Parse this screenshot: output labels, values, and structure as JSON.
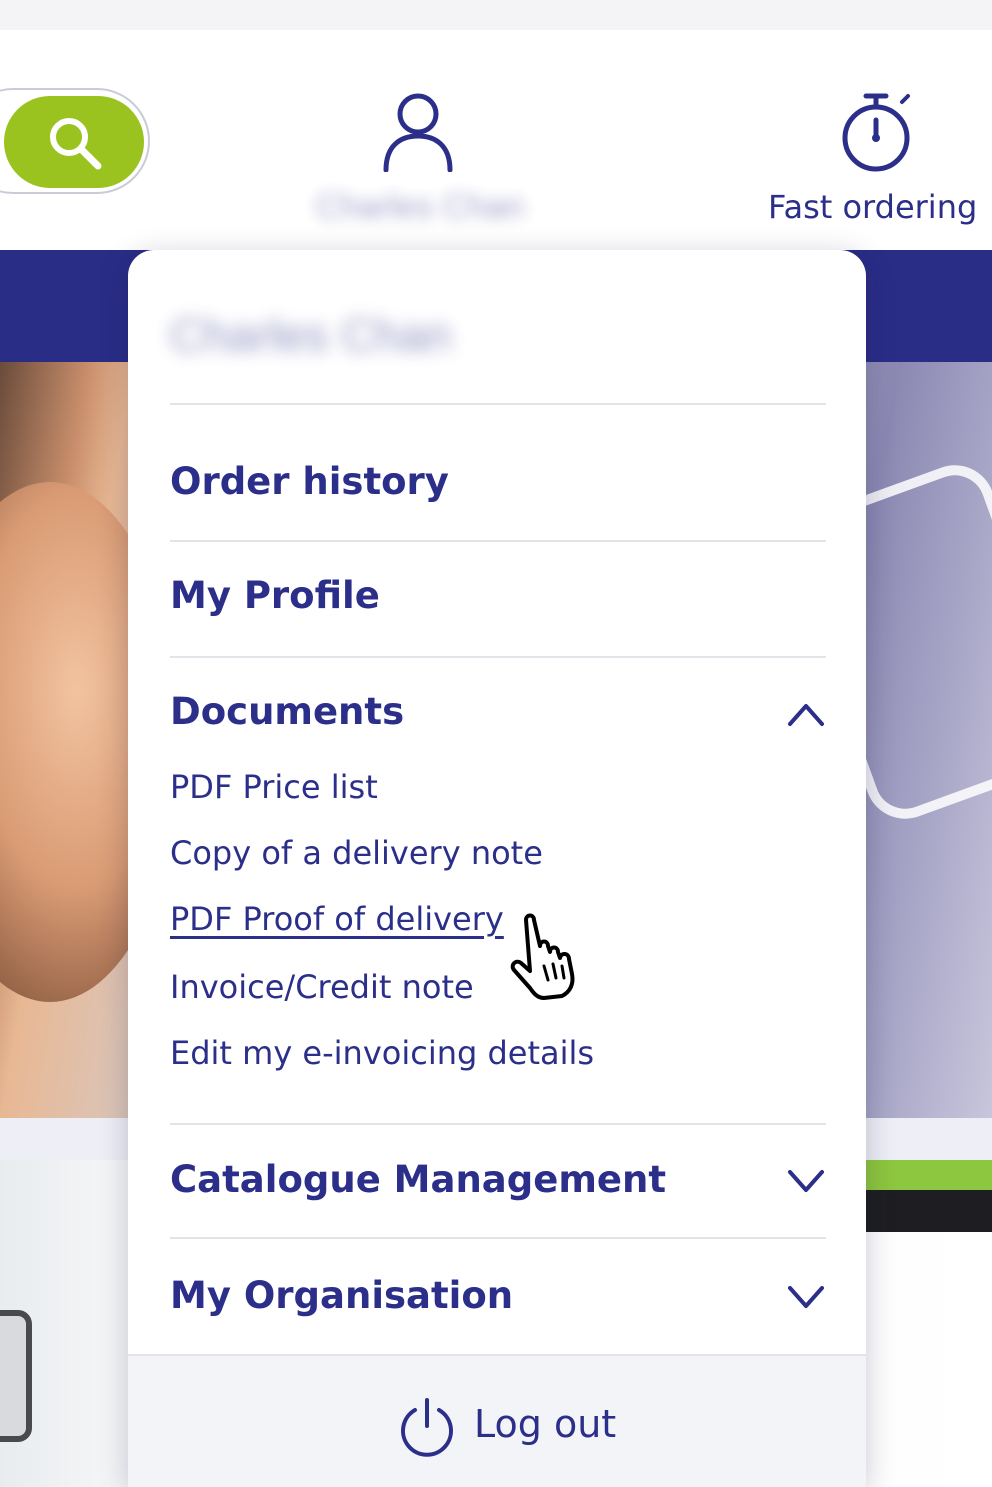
{
  "header": {
    "search": {
      "icon": "search-icon",
      "color": "#9bc31f"
    },
    "account": {
      "icon": "user-icon",
      "name": "Charles Chan"
    },
    "fast_ordering": {
      "icon": "stopwatch-icon",
      "label": "Fast ordering"
    }
  },
  "colors": {
    "brand_navy": "#2a2d86",
    "text_navy": "#2b2f8a",
    "accent_green": "#9bc31f",
    "divider": "#e3e4ea"
  },
  "dropdown": {
    "user_name": "Charles Chan",
    "items": [
      {
        "label": "Order history"
      },
      {
        "label": "My Profile"
      },
      {
        "label": "Documents",
        "expanded": true,
        "icon": "chevron-up-icon",
        "links": [
          "PDF Price list",
          "Copy of a delivery note",
          "PDF Proof of delivery",
          "Invoice/Credit note",
          "Edit my e-invoicing details"
        ]
      },
      {
        "label": "Catalogue Management",
        "expanded": false,
        "icon": "chevron-down-icon"
      },
      {
        "label": "My Organisation",
        "expanded": false,
        "icon": "chevron-down-icon"
      }
    ],
    "hovered_link": "PDF Proof of delivery",
    "logout": {
      "label": "Log out",
      "icon": "power-icon"
    }
  },
  "cursor": {
    "icon": "hand-pointer-icon"
  }
}
